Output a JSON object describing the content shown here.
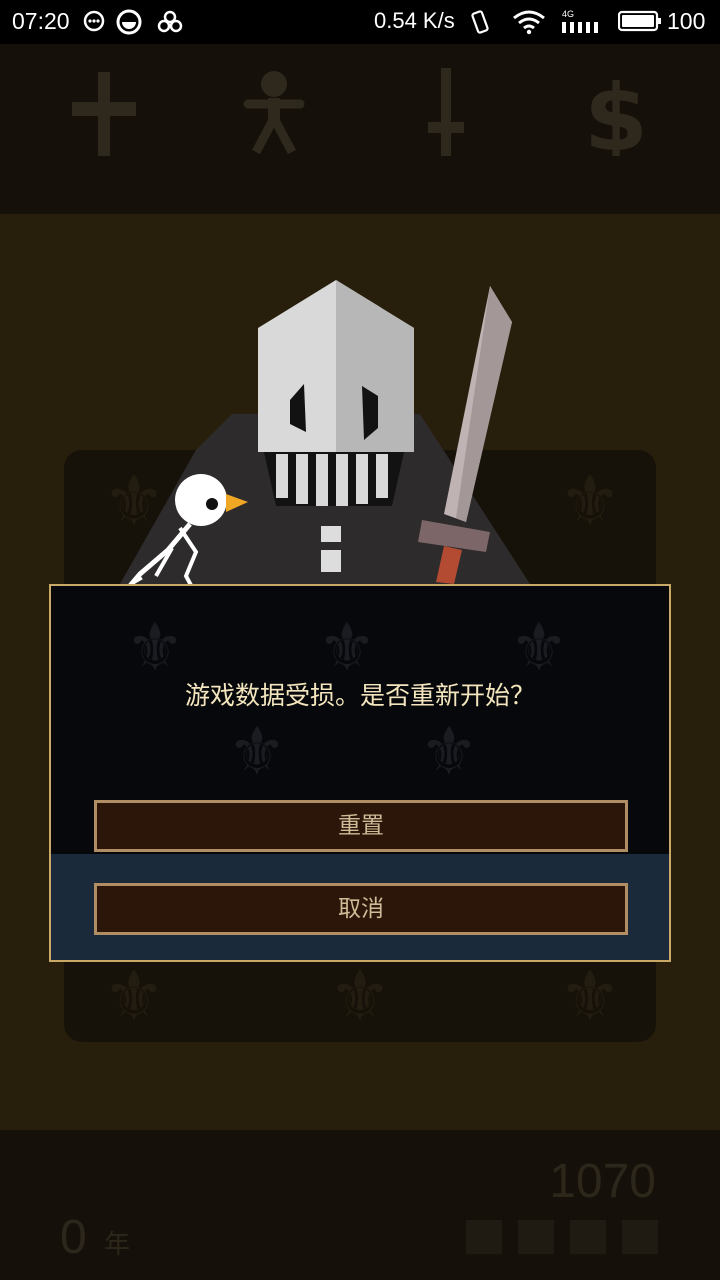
{
  "status_bar": {
    "time": "07:20",
    "net_speed": "0.54 K/s",
    "battery_level": "100",
    "network_type": "4G"
  },
  "top_bar": {
    "icons": [
      "cross-icon",
      "person-icon",
      "sword-icon",
      "dollar-icon"
    ]
  },
  "dialog": {
    "message": "游戏数据受损。是否重新开始？",
    "reset_label": "重置",
    "cancel_label": "取消"
  },
  "bottom_bar": {
    "years": "0",
    "years_unit": "年",
    "score": "1070"
  },
  "colors": {
    "stage_bg": "#271e0c",
    "bar_bg": "#15110a",
    "dialog_border": "#c9a868",
    "dialog_footer": "#1b2a3b",
    "button_bg": "#2c1609",
    "button_border": "#b08d63",
    "message_text": "#f3e5bd"
  }
}
